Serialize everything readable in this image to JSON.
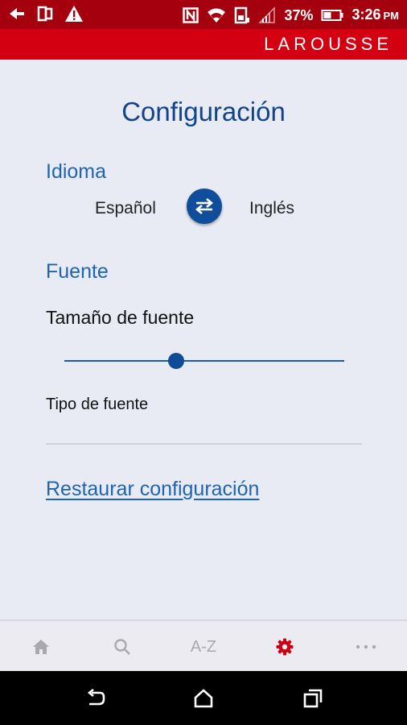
{
  "status_bar": {
    "battery_percent": "37%",
    "time": "3:26",
    "time_suffix": "PM",
    "icons": [
      "back-arrow-icon",
      "dual-screen-icon",
      "warning-icon",
      "nfc-icon",
      "wifi-icon",
      "storage-icon",
      "signal-icon",
      "battery-icon"
    ]
  },
  "app_bar": {
    "brand": "LAROUSSE"
  },
  "page": {
    "title": "Configuración",
    "language": {
      "heading": "Idioma",
      "source": "Español",
      "target": "Inglés",
      "swap_icon": "swap-arrows-icon"
    },
    "font": {
      "heading": "Fuente",
      "size_label": "Tamaño de fuente",
      "size_value_fraction": 0.4,
      "type_label": "Tipo de fuente"
    },
    "reset_link": "Restaurar configuración"
  },
  "bottom_nav": {
    "items": [
      {
        "name": "home",
        "icon": "home-icon"
      },
      {
        "name": "search",
        "icon": "search-icon"
      },
      {
        "name": "a-z",
        "label": "A-Z"
      },
      {
        "name": "settings",
        "icon": "gear-icon",
        "active": true
      },
      {
        "name": "more",
        "icon": "more-icon"
      }
    ]
  },
  "system_nav": {
    "icons": [
      "back-icon",
      "home-icon",
      "recents-icon"
    ]
  },
  "colors": {
    "status_bar": "#a5000e",
    "app_bar": "#d20010",
    "background": "#e9ebf4",
    "title": "#12448c",
    "accent": "#1f64b0",
    "active_nav": "#cc0010",
    "inactive_nav": "#a8a8ae"
  }
}
